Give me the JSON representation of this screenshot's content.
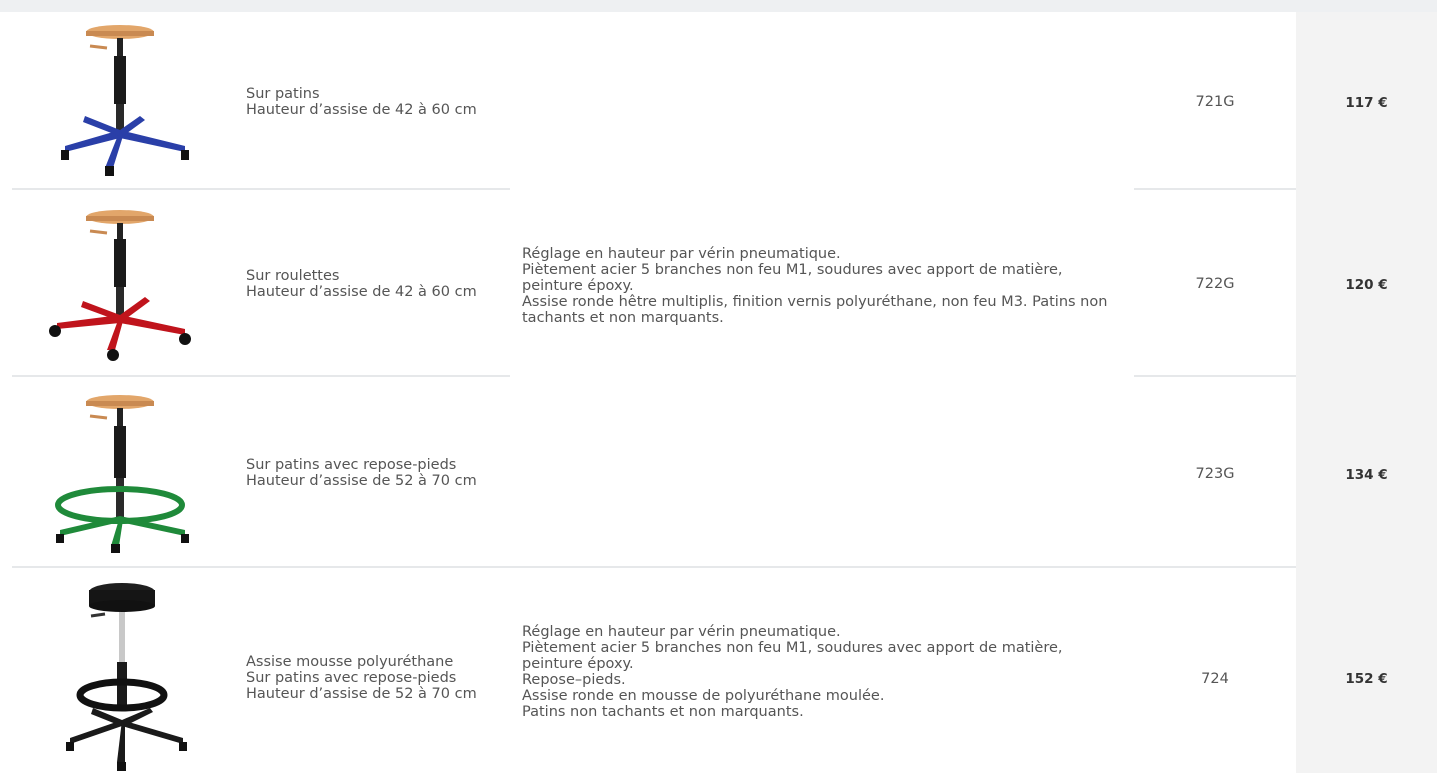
{
  "products": [
    {
      "image": "wood-stool-blue-base-glides",
      "variant_lines": [
        "Sur patins",
        "Hauteur d’assise de 42 à 60 cm"
      ],
      "ref": "721G",
      "price": "117 €"
    },
    {
      "image": "wood-stool-red-base-casters",
      "variant_lines": [
        "Sur roulettes",
        "Hauteur d’assise de 42 à 60 cm"
      ],
      "ref": "722G",
      "price": "120 €"
    },
    {
      "image": "wood-stool-green-base-footrest",
      "variant_lines": [
        "Sur patins avec repose-pieds",
        "Hauteur d’assise de 52 à 70 cm"
      ],
      "ref": "723G",
      "price": "134 €"
    },
    {
      "image": "black-foam-stool-footrest",
      "variant_lines": [
        "Assise mousse polyuréthane",
        "Sur patins avec repose-pieds",
        "Hauteur d’assise de 52 à 70 cm"
      ],
      "ref": "724",
      "price": "152 €"
    }
  ],
  "shared_description": [
    "Réglage en hauteur par vérin pneumatique.",
    "Piètement acier 5 branches non feu M1, soudures avec apport de matière,",
    "peinture époxy.",
    "Assise ronde hêtre multiplis, finition vernis polyuréthane, non feu M3. Patins non",
    "tachants et non marquants."
  ],
  "foam_description": [
    "Réglage en hauteur par vérin pneumatique.",
    "Piètement acier 5 branches non feu M1, soudures avec apport de matière,",
    "peinture époxy.",
    "Repose–pieds.",
    "Assise ronde en mousse de polyuréthane moulée.",
    "Patins non tachants et non marquants."
  ],
  "colors": {
    "blue_base": "#2a3fa8",
    "red_base": "#c0141c",
    "green_base": "#1f8a3a",
    "wood_seat": "#e2a66a",
    "black": "#1a1a1a"
  }
}
